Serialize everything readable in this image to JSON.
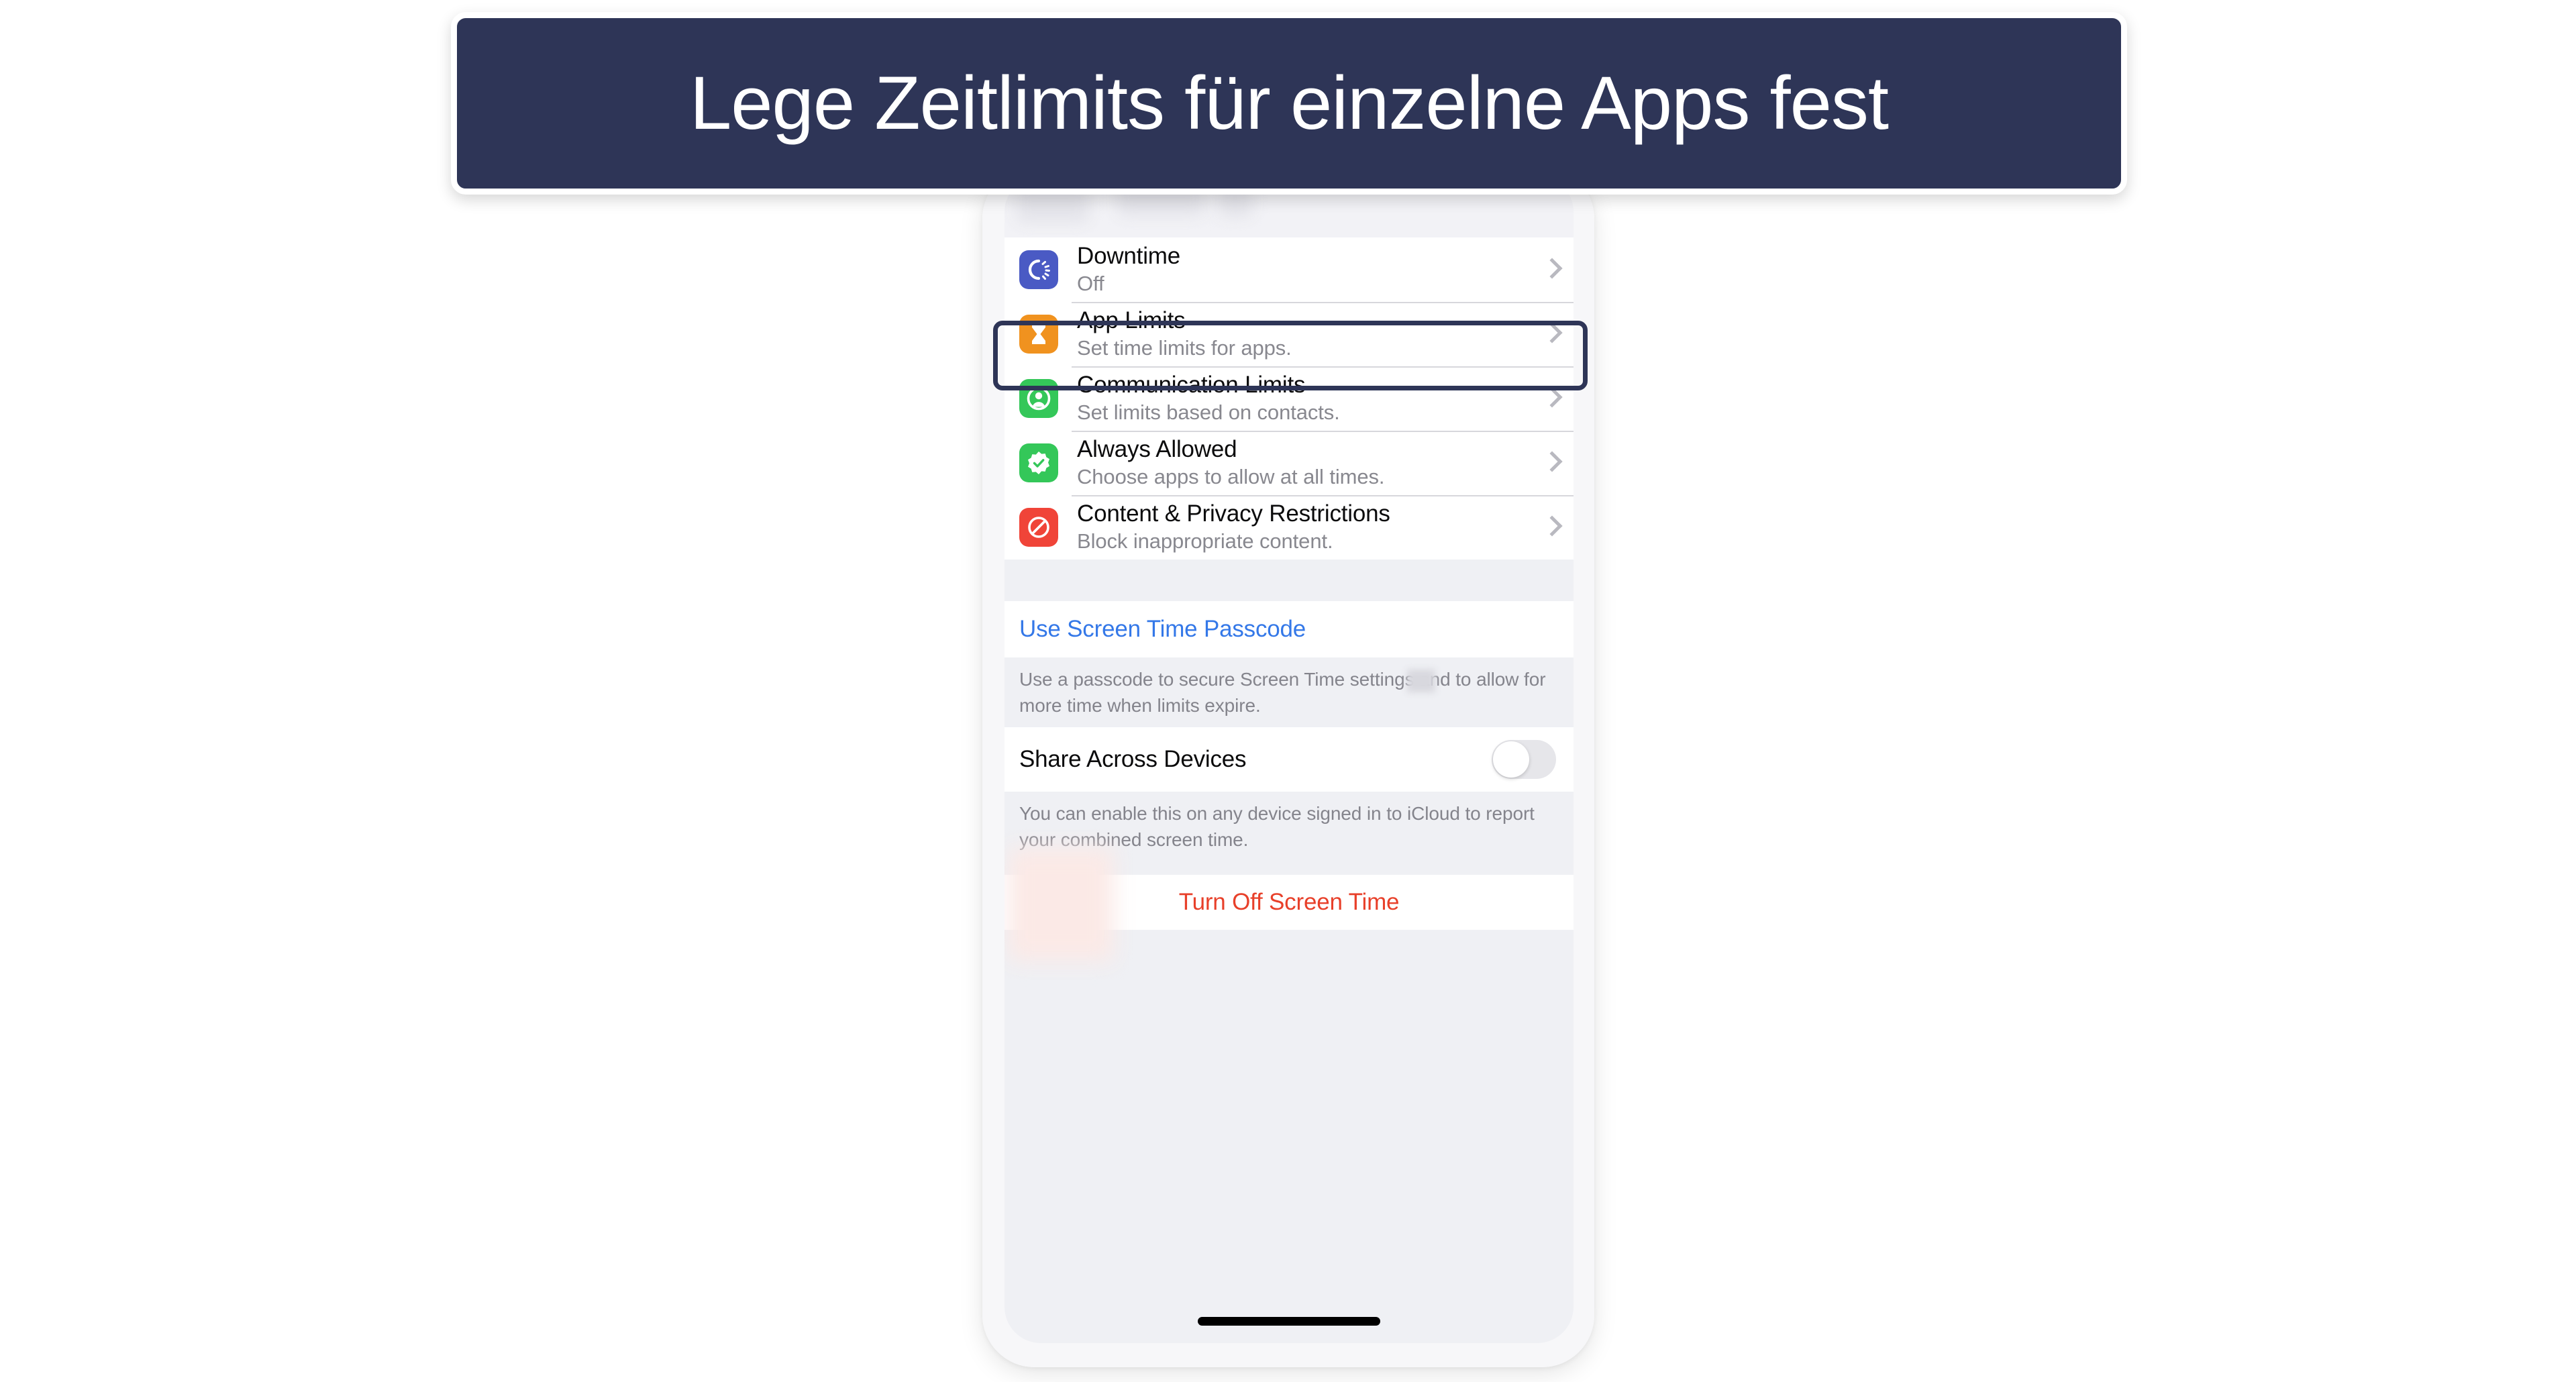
{
  "banner": {
    "text": "Lege Zeitlimits für einzelne Apps fest",
    "background_color": "#2e3557",
    "text_color": "#ffffff"
  },
  "phone": {
    "screen": {
      "title_area_obscured": true,
      "settings_group": {
        "rows": [
          {
            "title": "Downtime",
            "subtitle": "Off",
            "icon": "downtime-icon",
            "icon_color": "#4a5ac4",
            "chevron": "chevron-right-icon",
            "highlighted": false
          },
          {
            "title": "App Limits",
            "subtitle": "Set time limits for apps.",
            "icon": "hourglass-icon",
            "icon_color": "#f0921f",
            "chevron": "chevron-right-icon",
            "highlighted": true
          },
          {
            "title": "Communication Limits",
            "subtitle": "Set limits based on contacts.",
            "icon": "person-circle-icon",
            "icon_color": "#34c759",
            "chevron": "chevron-right-icon",
            "highlighted": false
          },
          {
            "title": "Always Allowed",
            "subtitle": "Choose apps to allow at all times.",
            "icon": "checkmark-seal-icon",
            "icon_color": "#34c759",
            "chevron": "chevron-right-icon",
            "highlighted": false
          },
          {
            "title": "Content & Privacy Restrictions",
            "subtitle": "Block inappropriate content.",
            "icon": "prohibition-icon",
            "icon_color": "#f04438",
            "chevron": "chevron-right-icon",
            "highlighted": false
          }
        ]
      },
      "passcode": {
        "link_label": "Use Screen Time Passcode",
        "link_color": "#3478e8",
        "footnote": "Use a passcode to secure Screen Time settings and to allow for more time when limits expire."
      },
      "share": {
        "label": "Share Across Devices",
        "toggle_state": "off",
        "footnote": "You can enable this on any device signed in to iCloud to report your combined screen time."
      },
      "turn_off": {
        "label": "Turn Off Screen Time",
        "visible_label": "creen Time",
        "color": "#e8402a"
      },
      "home_indicator": true
    }
  }
}
